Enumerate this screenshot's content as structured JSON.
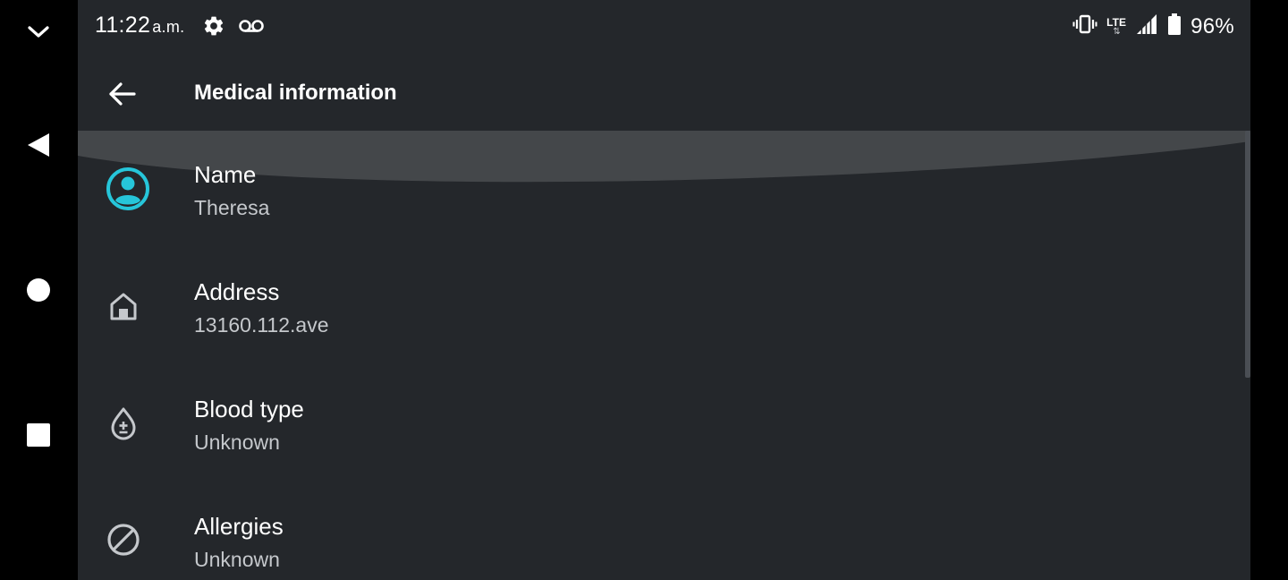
{
  "status_bar": {
    "time": "11:22",
    "ampm": "a.m.",
    "network": "LTE",
    "network_arrows": "⇅",
    "battery": "96%",
    "icons": [
      "settings-icon",
      "voicemail-icon",
      "vibrate-icon",
      "lte-icon",
      "signal-icon",
      "battery-icon"
    ]
  },
  "toolbar": {
    "title": "Medical information",
    "back_icon": "arrow-left-icon"
  },
  "items": [
    {
      "icon": "account-circle-icon",
      "title": "Name",
      "value": "Theresa"
    },
    {
      "icon": "home-icon",
      "title": "Address",
      "value": "13160.112.ave"
    },
    {
      "icon": "blood-drop-icon",
      "title": "Blood type",
      "value": "Unknown"
    },
    {
      "icon": "block-icon",
      "title": "Allergies",
      "value": "Unknown"
    }
  ],
  "nav_bar": {
    "icons": [
      "chevron-down-icon",
      "back-triangle-icon",
      "home-circle-icon",
      "recents-square-icon"
    ]
  },
  "colors": {
    "background": "#24272b",
    "accent": "#26c6da",
    "text_primary": "#ffffff",
    "text_secondary": "#c5c8cc"
  }
}
